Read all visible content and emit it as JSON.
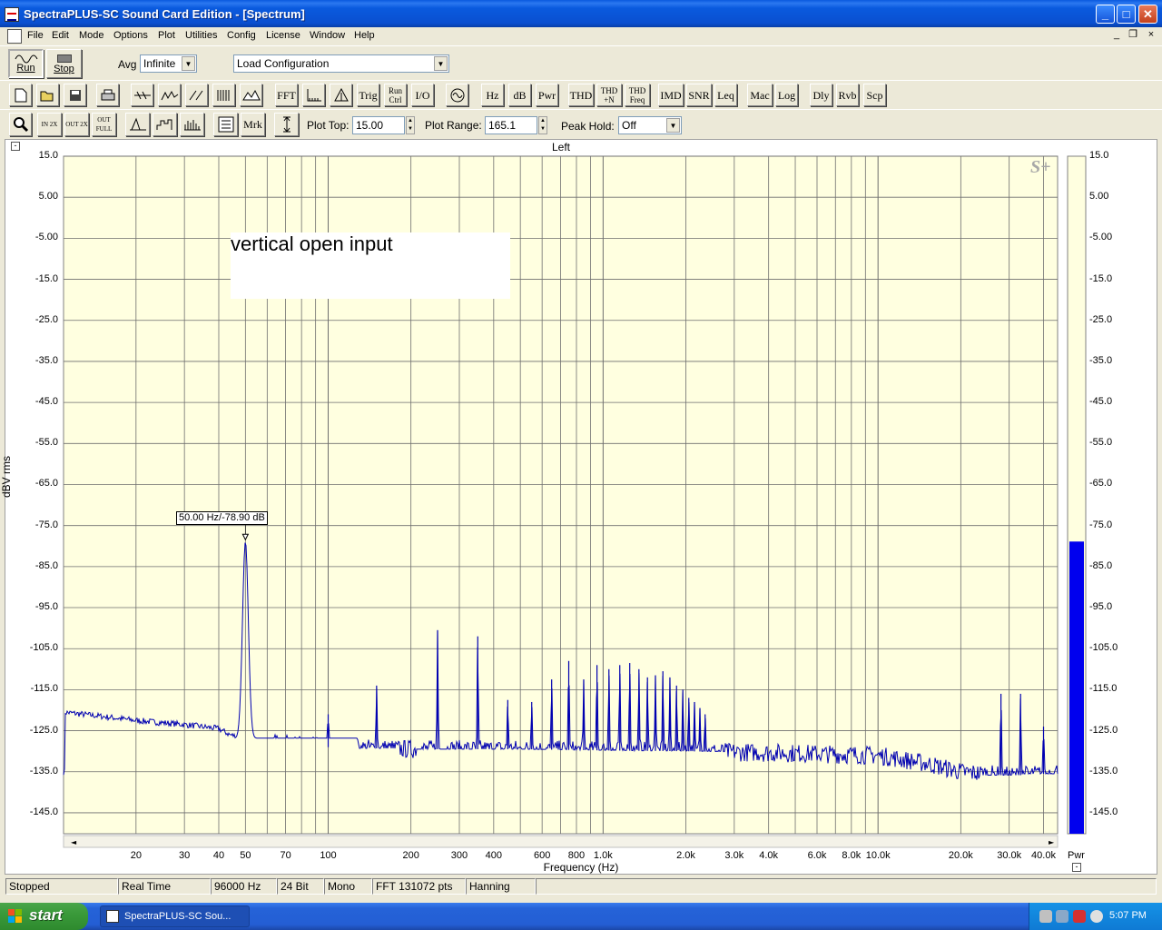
{
  "window": {
    "title": "SpectraPLUS-SC Sound Card Edition - [Spectrum]",
    "min_glyph": "_",
    "max_glyph": "□",
    "close_glyph": "✕"
  },
  "menu": {
    "items": [
      "File",
      "Edit",
      "Mode",
      "Options",
      "Plot",
      "Utilities",
      "Config",
      "License",
      "Window",
      "Help"
    ],
    "mdi_min": "_",
    "mdi_restore": "❐",
    "mdi_close": "×"
  },
  "toolbar1": {
    "run_label": "Run",
    "stop_label": "Stop",
    "avg_label": "Avg",
    "avg_value": "Infinite",
    "config_value": "Load Configuration"
  },
  "toolbar2": {
    "buttons": [
      "FFT",
      "Trig",
      "Run Ctrl",
      "I/O",
      "Hz",
      "dB",
      "Pwr",
      "THD",
      "THD +N",
      "THD Freq",
      "IMD",
      "SNR",
      "Leq",
      "Mac",
      "Log",
      "Dly",
      "Rvb",
      "Scp"
    ]
  },
  "toolbar3": {
    "zoom_in_label": "IN 2X",
    "zoom_out_label": "OUT 2X",
    "zoom_full_label": "OUT FULL",
    "marker_label": "Mrk",
    "plot_top_label": "Plot Top:",
    "plot_top_value": "15.00",
    "plot_range_label": "Plot Range:",
    "plot_range_value": "165.1",
    "peak_hold_label": "Peak Hold:",
    "peak_hold_value": "Off"
  },
  "plot": {
    "channel_label": "Left",
    "annotation": "vertical open input",
    "marker_text": "50.00 Hz/-78.90 dB",
    "logo": "S+",
    "meter_label": "Pwr",
    "collapse_glyph": "-"
  },
  "chart_data": {
    "type": "line",
    "title": "Left",
    "xlabel": "Frequency (Hz)",
    "ylabel": "dBV rms",
    "x_scale": "log",
    "xlim": [
      10.9,
      45000
    ],
    "ylim": [
      -150.1,
      15.0
    ],
    "grid": true,
    "y_tick_labels": [
      "15.0",
      "5.00",
      "-5.00",
      "-15.0",
      "-25.0",
      "-35.0",
      "-45.0",
      "-55.0",
      "-65.0",
      "-75.0",
      "-85.0",
      "-95.0",
      "-105.0",
      "-115.0",
      "-125.0",
      "-135.0",
      "-145.0"
    ],
    "x_tick_labels": [
      "20",
      "30",
      "40",
      "50",
      "70",
      "100",
      "200",
      "300",
      "400",
      "600",
      "800",
      "1.0k",
      "2.0k",
      "3.0k",
      "4.0k",
      "6.0k",
      "8.0k",
      "10.0k",
      "20.0k",
      "30.0k",
      "40.0k"
    ],
    "x_tick_values": [
      20,
      30,
      40,
      50,
      70,
      100,
      200,
      300,
      400,
      600,
      800,
      1000,
      2000,
      3000,
      4000,
      6000,
      8000,
      10000,
      20000,
      30000,
      40000
    ],
    "series": [
      {
        "baseline_points": [
          [
            11,
            -120.5
          ],
          [
            15,
            -121.5
          ],
          [
            20,
            -122.5
          ],
          [
            30,
            -123.5
          ],
          [
            40,
            -124.5
          ],
          [
            44,
            -126
          ],
          [
            60,
            -128
          ],
          [
            100,
            -129
          ],
          [
            200,
            -129.5
          ],
          [
            500,
            -129.5
          ],
          [
            1000,
            -129.8
          ],
          [
            2000,
            -130
          ],
          [
            5000,
            -130.5
          ],
          [
            10000,
            -131
          ],
          [
            15000,
            -133
          ],
          [
            20000,
            -135
          ],
          [
            30000,
            -136
          ],
          [
            40000,
            -135.5
          ],
          [
            45000,
            -135
          ]
        ],
        "peaks": [
          [
            50,
            -78.9
          ],
          [
            100,
            -121
          ],
          [
            150,
            -114
          ],
          [
            250,
            -100.5
          ],
          [
            350,
            -102
          ],
          [
            450,
            -117.5
          ],
          [
            550,
            -118
          ],
          [
            650,
            -112.5
          ],
          [
            750,
            -108
          ],
          [
            850,
            -112.5
          ],
          [
            950,
            -109
          ],
          [
            1050,
            -110
          ],
          [
            1150,
            -109
          ],
          [
            1250,
            -108.5
          ],
          [
            1350,
            -110
          ],
          [
            1450,
            -112
          ],
          [
            1550,
            -111.5
          ],
          [
            1650,
            -110.5
          ],
          [
            1750,
            -112
          ],
          [
            1850,
            -114
          ],
          [
            1950,
            -115
          ],
          [
            2050,
            -117
          ],
          [
            2150,
            -118
          ],
          [
            2250,
            -119.5
          ],
          [
            2350,
            -121
          ],
          [
            28000,
            -116
          ],
          [
            33000,
            -116
          ],
          [
            40000,
            -124
          ]
        ]
      }
    ],
    "marker": {
      "x": 50,
      "y": -78.9,
      "label": "50.00 Hz/-78.90 dB"
    },
    "meter": {
      "label": "Pwr",
      "level_db": -78.9,
      "color": "#0000ee"
    },
    "colors": {
      "plot_background": "#ffffe0",
      "trace": "#0000b0",
      "grid": "#6e6e6e"
    }
  },
  "statusbar": {
    "fields": [
      "Stopped",
      "Real Time",
      "96000 Hz",
      "24 Bit",
      "Mono",
      "FFT 131072 pts",
      "Hanning"
    ]
  },
  "taskbar": {
    "start_label": "start",
    "task_label": "SpectraPLUS-SC Sou...",
    "clock": "5:07 PM"
  }
}
